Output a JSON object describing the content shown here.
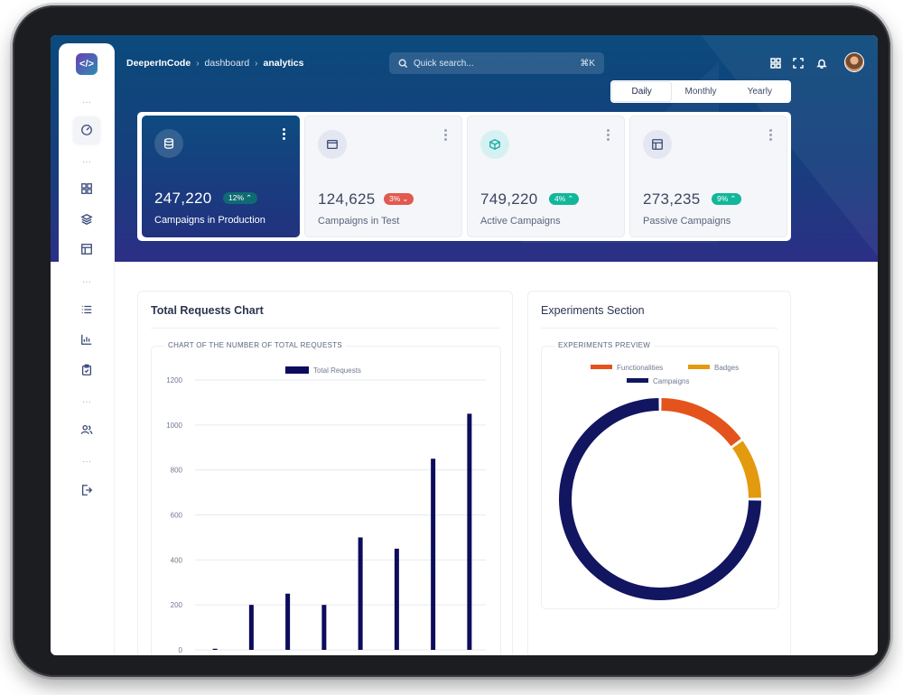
{
  "breadcrumb": {
    "root": "DeeperInCode",
    "mid": "dashboard",
    "current": "analytics"
  },
  "search": {
    "placeholder": "Quick search...",
    "shortcut": "⌘K"
  },
  "toggle": {
    "options": [
      "Daily",
      "Monthly",
      "Yearly"
    ],
    "selected": "Daily"
  },
  "sidebar": {
    "icons": [
      "dashboard-icon",
      "grid-icon",
      "layers-icon",
      "table-icon",
      "list-icon",
      "bar-chart-icon",
      "clipboard-icon",
      "users-icon",
      "logout-icon"
    ]
  },
  "topbar_icons": [
    "apps-icon",
    "fullscreen-icon",
    "bell-icon"
  ],
  "stats": [
    {
      "value": "247,220",
      "badge": "12%",
      "trend": "up",
      "badge_color": "#0f6b73",
      "label": "Campaigns in Production",
      "icon": "database-icon"
    },
    {
      "value": "124,625",
      "badge": "3%",
      "trend": "down",
      "badge_color": "#e15a4f",
      "label": "Campaigns in Test",
      "icon": "browser-icon"
    },
    {
      "value": "749,220",
      "badge": "4%",
      "trend": "up",
      "badge_color": "#11b79a",
      "label": "Active Campaigns",
      "icon": "cube-icon"
    },
    {
      "value": "273,235",
      "badge": "9%",
      "trend": "up",
      "badge_color": "#11b79a",
      "label": "Passive Campaigns",
      "icon": "layout-icon"
    }
  ],
  "requests_panel": {
    "title": "Total Requests Chart",
    "section_label": "CHART OF THE NUMBER OF TOTAL REQUESTS"
  },
  "experiments_panel": {
    "title": "Experiments Section",
    "section_label": "EXPERIMENTS PREVIEW"
  },
  "chart_data": [
    {
      "type": "bar",
      "legend": [
        "Total Requests"
      ],
      "series": [
        {
          "name": "Total Requests",
          "color": "#0c0b5c",
          "values": [
            5,
            200,
            250,
            200,
            500,
            450,
            850,
            1050
          ]
        }
      ],
      "y_ticks": [
        0,
        200,
        400,
        600,
        800,
        1000,
        1200
      ],
      "ylim": [
        0,
        1200
      ],
      "grid": true
    },
    {
      "type": "pie",
      "donut": true,
      "legend": [
        "Functionalities",
        "Badges",
        "Campaigns"
      ],
      "slices": [
        {
          "name": "Functionalities",
          "value": 15,
          "color": "#e4531c"
        },
        {
          "name": "Badges",
          "value": 10,
          "color": "#e39a0e"
        },
        {
          "name": "Campaigns",
          "value": 75,
          "color": "#12155f"
        }
      ]
    }
  ]
}
